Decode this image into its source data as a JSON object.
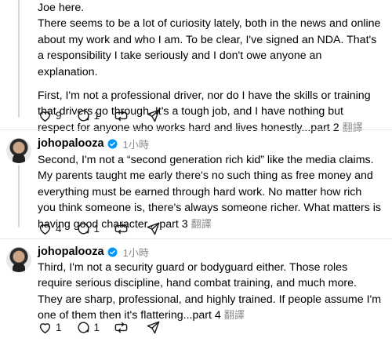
{
  "post1": {
    "paragraph1_line": "Joe here.",
    "paragraph1": "There seems to be a lot of curiosity lately, both in the news and online about my work and who I am. To be clear, I've signed an NDA. That's a responsibility I take seriously and I don't owe anyone an explanation.",
    "paragraph2": "First, I'm not a professional driver, nor do I have the skills or training that drivers go through. It's a tough job, and I have nothing but respect for anyone who works hard and lives honestly...part 2",
    "translate": "翻譯",
    "likes": "9",
    "replies": "1"
  },
  "post2": {
    "username": "johopalooza",
    "time": "1小時",
    "text": "Second, I'm not a “second generation rich kid” like the media claims. My parents taught me early there's no such thing as free money and everything must be earned through hard work. No matter how rich you think someone is, there's always someone richer. What matters is having good character....part 3",
    "translate": "翻譯",
    "likes": "4",
    "replies": "1"
  },
  "post3": {
    "username": "johopalooza",
    "time": "1小時",
    "text": "Third, I'm not a security guard or bodyguard either. Those roles require serious discipline, hand combat training, and much more. They are sharp, professional, and highly trained. If people assume I'm one of them then it's flattering...part 4",
    "translate": "翻譯",
    "likes": "1",
    "replies": "1"
  },
  "icons": {
    "like": "heart-icon",
    "reply": "comment-icon",
    "repost": "repost-icon",
    "share": "send-icon",
    "verified": "verified-badge-icon"
  },
  "colors": {
    "verified": "#0095f6",
    "muted": "#8a8a8a",
    "divider": "#e6e6e6"
  }
}
